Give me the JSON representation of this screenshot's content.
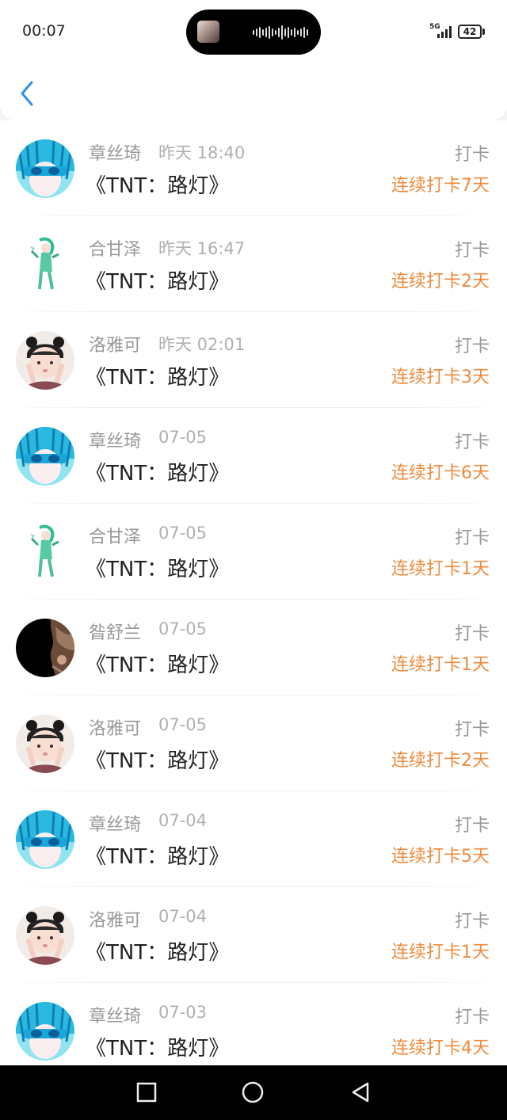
{
  "status_bar": {
    "time": "00:07",
    "network": "5G",
    "battery": "42"
  },
  "header": {
    "back_icon": "chevron-left-icon",
    "accent_color": "#2e8fe6"
  },
  "feed": {
    "streak_color": "#f08a3c",
    "items": [
      {
        "name": "章丝琦",
        "time": "昨天 18:40",
        "title": "《TNT：路灯》",
        "action": "打卡",
        "streak": "连续打卡7天",
        "avatar": "anime-blue"
      },
      {
        "name": "合甘泽",
        "time": "昨天 16:47",
        "title": "《TNT：路灯》",
        "action": "打卡",
        "streak": "连续打卡2天",
        "avatar": "anime-green"
      },
      {
        "name": "洛雅可",
        "time": "昨天 02:01",
        "title": "《TNT：路灯》",
        "action": "打卡",
        "streak": "连续打卡3天",
        "avatar": "girl"
      },
      {
        "name": "章丝琦",
        "time": "07-05",
        "title": "《TNT：路灯》",
        "action": "打卡",
        "streak": "连续打卡6天",
        "avatar": "anime-blue"
      },
      {
        "name": "合甘泽",
        "time": "07-05",
        "title": "《TNT：路灯》",
        "action": "打卡",
        "streak": "连续打卡1天",
        "avatar": "anime-green"
      },
      {
        "name": "昝舒兰",
        "time": "07-05",
        "title": "《TNT：路灯》",
        "action": "打卡",
        "streak": "连续打卡1天",
        "avatar": "dark"
      },
      {
        "name": "洛雅可",
        "time": "07-05",
        "title": "《TNT：路灯》",
        "action": "打卡",
        "streak": "连续打卡2天",
        "avatar": "girl"
      },
      {
        "name": "章丝琦",
        "time": "07-04",
        "title": "《TNT：路灯》",
        "action": "打卡",
        "streak": "连续打卡5天",
        "avatar": "anime-blue"
      },
      {
        "name": "洛雅可",
        "time": "07-04",
        "title": "《TNT：路灯》",
        "action": "打卡",
        "streak": "连续打卡1天",
        "avatar": "girl"
      },
      {
        "name": "章丝琦",
        "time": "07-03",
        "title": "《TNT：路灯》",
        "action": "打卡",
        "streak": "连续打卡4天",
        "avatar": "anime-blue"
      }
    ]
  },
  "nav": {
    "recents_icon": "square-icon",
    "home_icon": "circle-icon",
    "back_icon": "triangle-back-icon"
  }
}
